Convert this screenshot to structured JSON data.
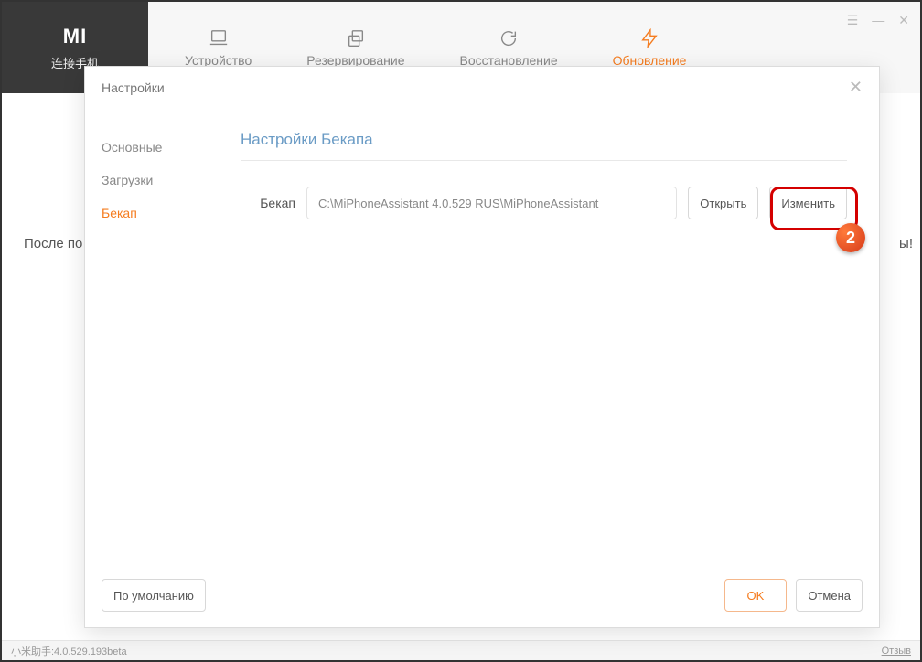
{
  "brand": {
    "logo": "MI",
    "sub": "连接手机"
  },
  "nav": {
    "device": "Устройство",
    "backup": "Резервирование",
    "restore": "Восстановление",
    "update": "Обновление"
  },
  "bg": {
    "left": "После по",
    "right": "ы!"
  },
  "status": {
    "ver": "小米助手:4.0.529.193beta",
    "review": "Отзыв"
  },
  "modal": {
    "title": "Настройки",
    "sidebar": {
      "main": "Основные",
      "downloads": "Загрузки",
      "backup": "Бекап"
    },
    "section_title": "Настройки Бекапа",
    "row_label": "Бекап",
    "path": "C:\\MiPhoneAssistant 4.0.529 RUS\\MiPhoneAssistant",
    "open": "Открыть",
    "change": "Изменить",
    "defaults": "По умолчанию",
    "ok": "OK",
    "cancel": "Отмена"
  },
  "annotation": {
    "num": "2"
  }
}
